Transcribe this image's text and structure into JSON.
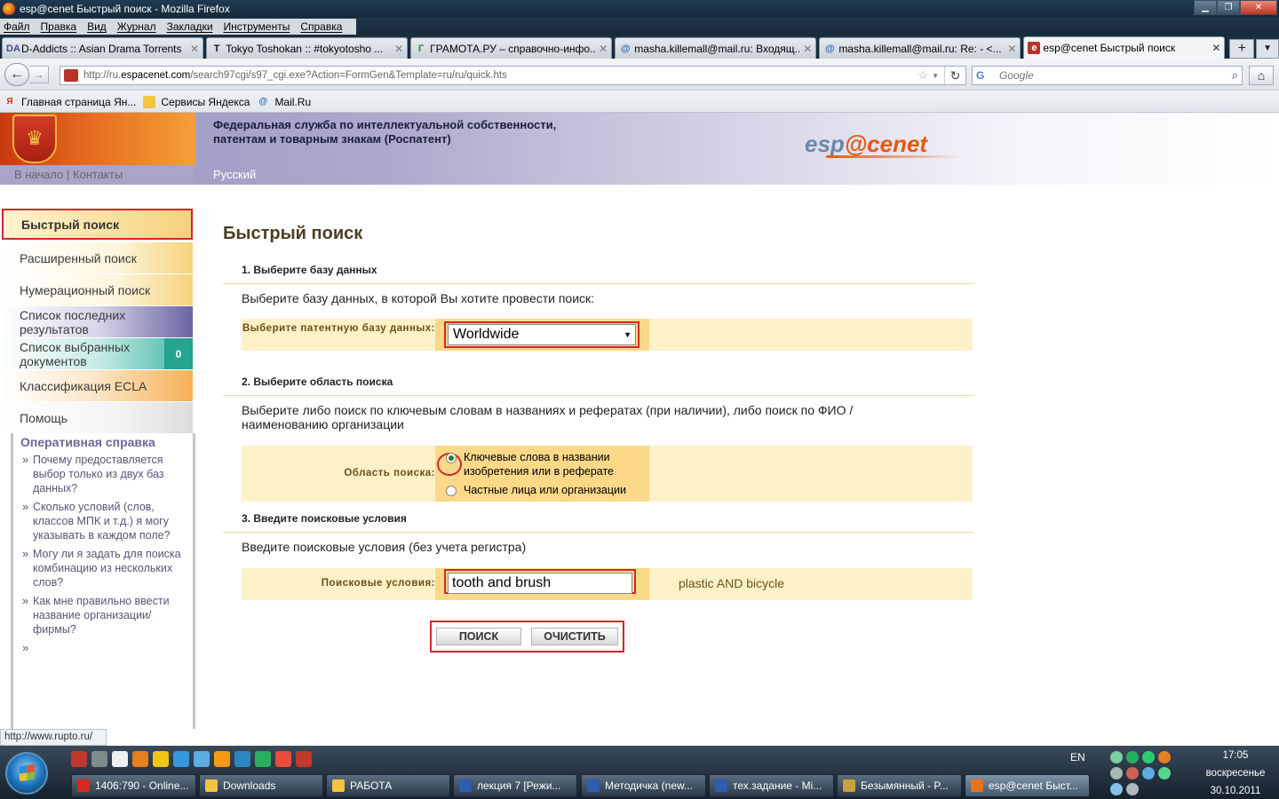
{
  "window": {
    "title": "esp@cenet Быстрый поиск - Mozilla Firefox",
    "controls": [
      "▁",
      "❐",
      "✕"
    ]
  },
  "menu": [
    "Файл",
    "Правка",
    "Вид",
    "Журнал",
    "Закладки",
    "Инструменты",
    "Справка"
  ],
  "tabs": [
    {
      "label": "D-Addicts :: Asian Drama Torrents",
      "icon": "da-icon",
      "icon_text": "DA",
      "color": "#3b4f8a"
    },
    {
      "label": "Tokyo Toshokan :: #tokyotosho ...",
      "icon": "t-icon",
      "icon_text": "T",
      "color": "#111111"
    },
    {
      "label": "ГРАМОТА.РУ – справочно-инфо...",
      "icon": "gramota-icon",
      "icon_text": "Г",
      "color": "#2c8a3c"
    },
    {
      "label": "masha.killemall@mail.ru: Входящ...",
      "icon": "mail-icon",
      "icon_text": "@",
      "color": "#2c6fb5"
    },
    {
      "label": "masha.killemall@mail.ru: Re: - <...",
      "icon": "mail-icon",
      "icon_text": "@",
      "color": "#2c6fb5"
    },
    {
      "label": "esp@cenet Быстрый поиск",
      "icon": "espacenet-icon",
      "icon_text": "e",
      "color": "#b8322a"
    }
  ],
  "navigation": {
    "url_prefix": "http://ru.",
    "url_domain": "espacenet.com",
    "url_rest": "/search97cgi/s97_cgi.exe?Action=FormGen&Template=ru/ru/quick.hts",
    "search_placeholder": "Google"
  },
  "bookmarks": [
    {
      "label": "Главная страница Ян...",
      "icon": "yandex-icon",
      "icon_text": "Я",
      "color": "#d52b1e"
    },
    {
      "label": "Сервисы Яндекса",
      "icon": "folder-icon",
      "icon_text": "",
      "color": "#f4c542"
    },
    {
      "label": "Mail.Ru",
      "icon": "mailru-icon",
      "icon_text": "@",
      "color": "#2c6fb5"
    }
  ],
  "banner": {
    "title_line1": "Федеральная служба по интеллектуальной собственности,",
    "title_line2": "патентам и товарным знакам (Роспатент)",
    "link_home": "В начало",
    "separator": "|",
    "link_contacts": "Контакты",
    "language": "Русский",
    "logo_part1": "esp",
    "logo_at": "@",
    "logo_part2": "cenet"
  },
  "sidebar": {
    "items": [
      {
        "label": "Быстрый поиск"
      },
      {
        "label": "Расширенный поиск"
      },
      {
        "label": "Нумерационный поиск"
      },
      {
        "label": "Список последних результатов"
      },
      {
        "label": "Список выбранных документов",
        "badge": "0"
      },
      {
        "label": "Классификация ECLA"
      },
      {
        "label": "Помощь"
      }
    ],
    "help_title": "Оперативная справка",
    "help_items": [
      "Почему предоставляется выбор только из двух баз данных?",
      "Сколько условий (слов, классов МПК и т.д.) я могу указывать в каждом поле?",
      "Могу ли я задать для поиска комбинацию из нескольких слов?",
      "Как мне правильно ввести название организации/фирмы?"
    ],
    "help_more": "»"
  },
  "main": {
    "heading": "Быстрый поиск",
    "section1": {
      "title": "1. Выберите базу данных",
      "text": "Выберите базу данных, в которой Вы хотите провести поиск:",
      "label": "Выберите патентную базу данных:",
      "selected": "Worldwide"
    },
    "section2": {
      "title": "2. Выберите область поиска",
      "text": "Выберите либо поиск по ключевым словам в названиях и рефератах (при наличии), либо поиск по ФИО / наименованию организации",
      "label": "Область поиска:",
      "option1": "Ключевые слова в названии изобретения или в реферате",
      "option2": "Частные лица или организации"
    },
    "section3": {
      "title": "3. Введите поисковые условия",
      "text": "Введите поисковые условия (без учета регистра)",
      "label": "Поисковые условия:",
      "value": "tooth and brush",
      "hint": "plastic AND bicycle"
    },
    "search_button": "ПОИСК",
    "clear_button": "ОЧИСТИТЬ"
  },
  "status": {
    "text": "http://www.rupto.ru/"
  },
  "taskbar": {
    "tasks": [
      {
        "label": "1406:790 - Online...",
        "color": "#d52b1e"
      },
      {
        "label": "Downloads",
        "color": "#f4c542"
      },
      {
        "label": "РАБОТА",
        "color": "#f4c542"
      },
      {
        "label": "лекция 7 [Режи...",
        "color": "#2b5fb5"
      },
      {
        "label": "Методичка (new...",
        "color": "#2b5fb5"
      },
      {
        "label": "тех.задание - Mi...",
        "color": "#2b5fb5"
      },
      {
        "label": "Безымянный - P...",
        "color": "#c9a23a"
      },
      {
        "label": "esp@cenet Быст...",
        "color": "#e8731c"
      }
    ],
    "language": "EN",
    "time": "17:05",
    "day": "воскресенье",
    "date": "30.10.2011"
  }
}
